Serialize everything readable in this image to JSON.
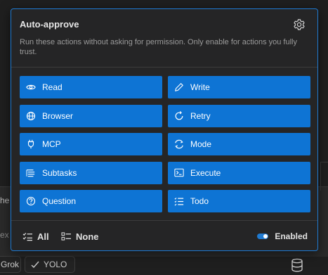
{
  "popup": {
    "title": "Auto-approve",
    "description": "Run these actions without asking for permission. Only enable for actions you fully trust.",
    "settings_icon": "gear-icon",
    "actions": [
      {
        "label": "Read",
        "icon": "eye-icon"
      },
      {
        "label": "Write",
        "icon": "pencil-icon"
      },
      {
        "label": "Browser",
        "icon": "globe-icon"
      },
      {
        "label": "Retry",
        "icon": "retry-icon"
      },
      {
        "label": "MCP",
        "icon": "plug-icon"
      },
      {
        "label": "Mode",
        "icon": "mode-icon"
      },
      {
        "label": "Subtasks",
        "icon": "subtasks-icon"
      },
      {
        "label": "Execute",
        "icon": "terminal-icon"
      },
      {
        "label": "Question",
        "icon": "question-icon"
      },
      {
        "label": "Todo",
        "icon": "todo-icon"
      }
    ],
    "footer": {
      "all_label": "All",
      "none_label": "None",
      "toggle_label": "Enabled",
      "toggle_on": true
    }
  },
  "background": {
    "fragment_top": "he",
    "fragment_bottom": "ex",
    "model_pill": "Grok",
    "yolo_pill": "YOLO"
  },
  "colors": {
    "accent": "#0e74d4",
    "border_accent": "#1f7ad1",
    "panel": "#252526"
  }
}
